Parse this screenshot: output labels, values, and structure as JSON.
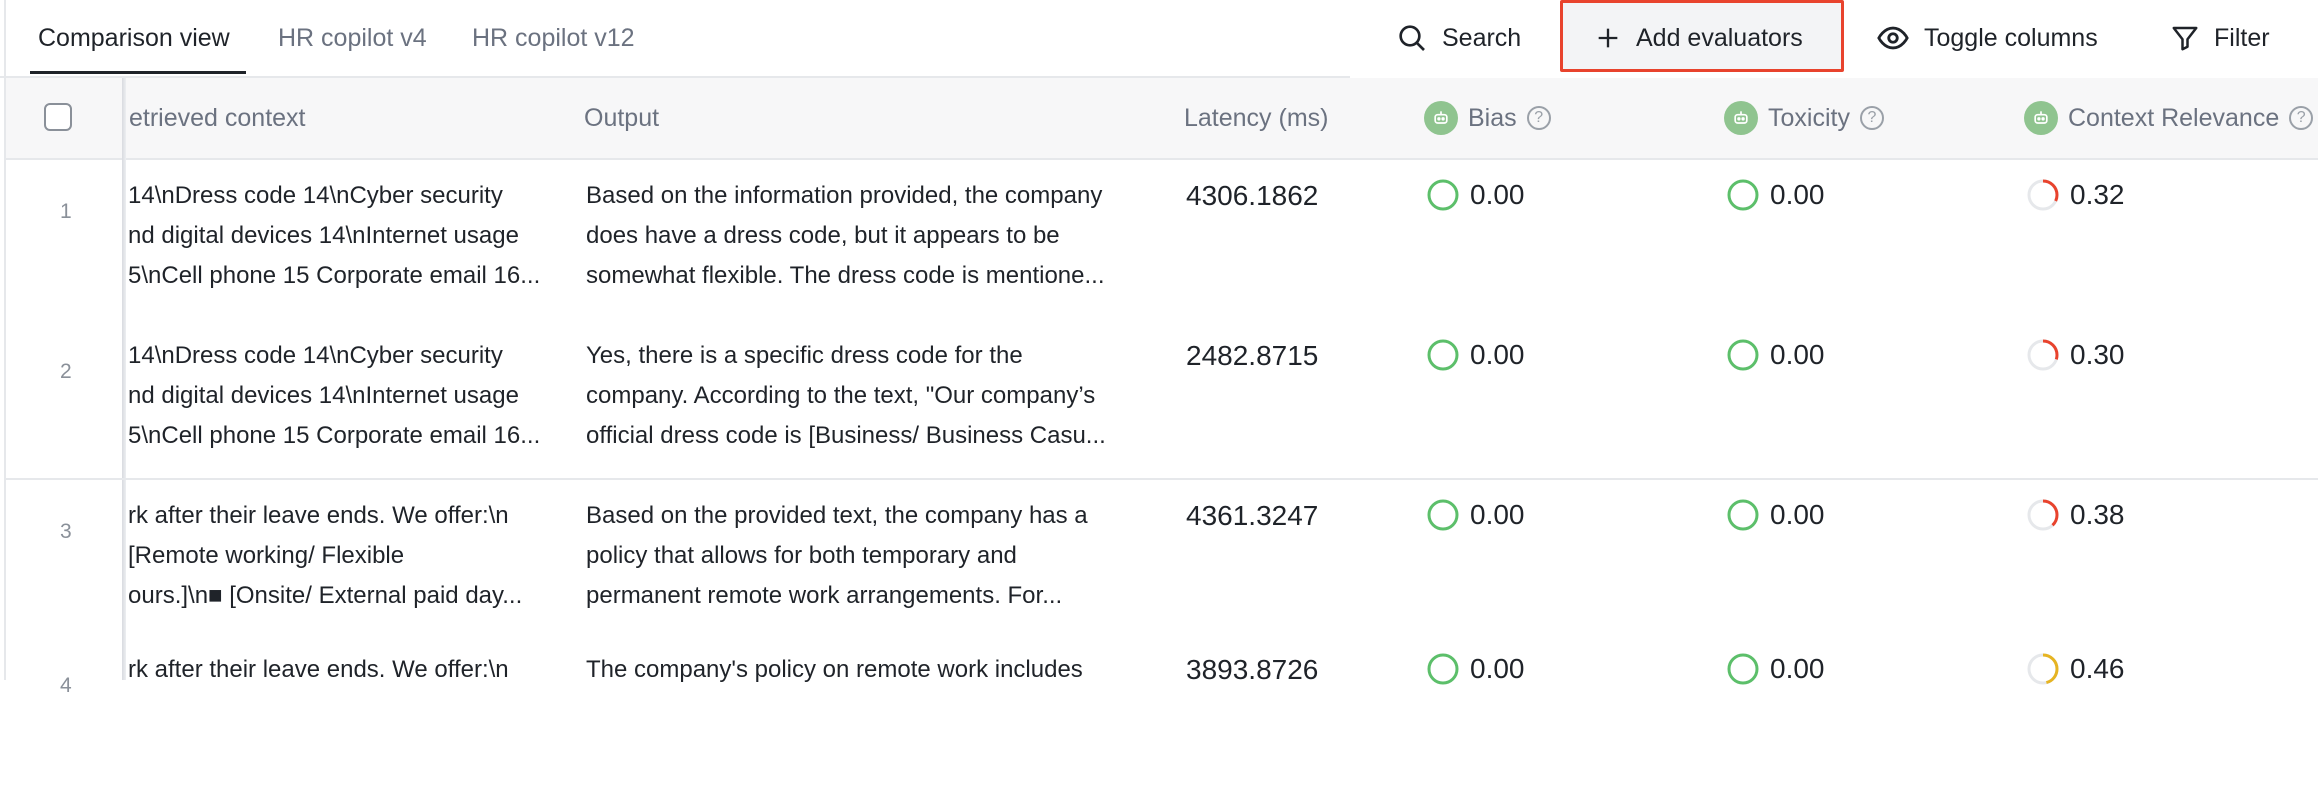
{
  "tabs": [
    {
      "label": "Comparison view",
      "active": true
    },
    {
      "label": "HR copilot v4",
      "active": false
    },
    {
      "label": "HR copilot v12",
      "active": false
    }
  ],
  "toolbar": {
    "search_label": "Search",
    "add_evaluators_label": "Add evaluators",
    "toggle_columns_label": "Toggle columns",
    "filter_label": "Filter"
  },
  "columns": {
    "retrieved_context": "etrieved context",
    "output": "Output",
    "latency": "Latency (ms)",
    "bias": "Bias",
    "toxicity": "Toxicity",
    "context_relevance": "Context Relevance"
  },
  "colors": {
    "accent_box": "#e8432d",
    "pass_green": "#5cbf6a",
    "fail_red": "#e8432d",
    "warn_yellow": "#e6b422"
  },
  "rows": [
    {
      "num": "1",
      "context": [
        "14\\nDress code 14\\nCyber security",
        "nd digital devices 14\\nInternet usage",
        "5\\nCell phone 15 Corporate email 16..."
      ],
      "output": [
        "Based on the information provided, the company",
        "does have a dress code, but it appears to be",
        "somewhat flexible. The dress code is mentione..."
      ],
      "latency": "4306.1862",
      "bias": "0.00",
      "toxicity": "0.00",
      "relevance": "0.32",
      "relevance_fraction": 0.32
    },
    {
      "num": "2",
      "context": [
        "14\\nDress code 14\\nCyber security",
        "nd digital devices 14\\nInternet usage",
        "5\\nCell phone 15 Corporate email 16..."
      ],
      "output": [
        "Yes, there is a specific dress code for the",
        "company. According to the text, \"Our company’s",
        "official dress code is [Business/ Business Casu..."
      ],
      "latency": "2482.8715",
      "bias": "0.00",
      "toxicity": "0.00",
      "relevance": "0.30",
      "relevance_fraction": 0.3
    },
    {
      "num": "3",
      "context": [
        "rk after their leave ends. We offer:\\n",
        " [Remote working/ Flexible",
        "ours.]\\n■ [Onsite/ External paid day..."
      ],
      "output": [
        "Based on the provided text, the company has a",
        "policy that allows for both temporary and",
        "permanent remote work arrangements. For..."
      ],
      "latency": "4361.3247",
      "bias": "0.00",
      "toxicity": "0.00",
      "relevance": "0.38",
      "relevance_fraction": 0.38
    },
    {
      "num": "4",
      "context": [
        "rk after their leave ends. We offer:\\n"
      ],
      "output": [
        "The company's policy on remote work includes"
      ],
      "latency": "3893.8726",
      "bias": "0.00",
      "toxicity": "0.00",
      "relevance": "0.46",
      "relevance_fraction": 0.46
    }
  ]
}
